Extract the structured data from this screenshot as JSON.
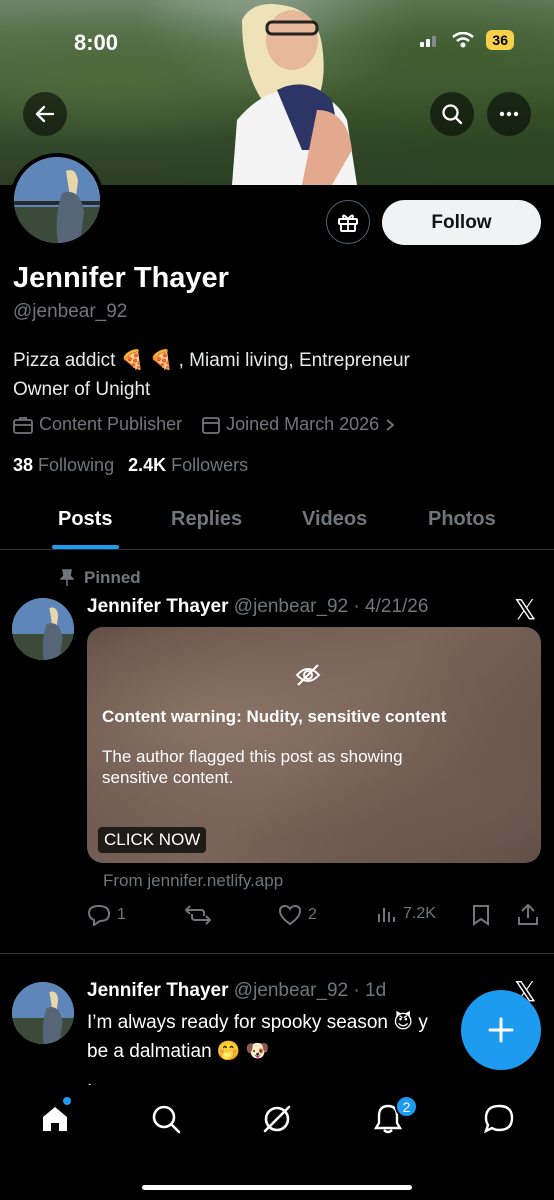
{
  "status_bar": {
    "time": "8:00",
    "battery": "36"
  },
  "profile": {
    "display_name": "Jennifer Thayer",
    "handle": "@jenbear_92",
    "bio_line1": "Pizza addict 🍕 🍕 , Miami living, Entrepreneur",
    "bio_line2": "Owner of Unight",
    "category": "Content Publisher",
    "joined": "Joined March 2026",
    "following_count": "38",
    "following_label": "Following",
    "followers_count": "2.4K",
    "followers_label": "Followers",
    "follow_button": "Follow"
  },
  "tabs": [
    "Posts",
    "Replies",
    "Videos",
    "Photos"
  ],
  "pinned_post": {
    "pinned_label": "Pinned",
    "author": "Jennifer Thayer",
    "handle_date": "@jenbear_92 · 4/21/26",
    "warning_title": "Content warning: Nudity, sensitive content",
    "warning_desc": "The author flagged this post as showing sensitive content.",
    "cta": "CLICK NOW",
    "from": "From jennifer.netlify.app",
    "replies": "1",
    "likes": "2",
    "views": "7.2K"
  },
  "second_post": {
    "author": "Jennifer Thayer",
    "handle_date": "@jenbear_92 · 1d",
    "text_line1": "I’m always ready for spooky season 😈 y",
    "text_line2": "be a dalmatian 🤭 🐶",
    "text_line3": "."
  },
  "nav": {
    "notifications_badge": "2"
  },
  "colors": {
    "accent": "#1d9bf0",
    "muted": "#71767b",
    "background": "#000000"
  }
}
